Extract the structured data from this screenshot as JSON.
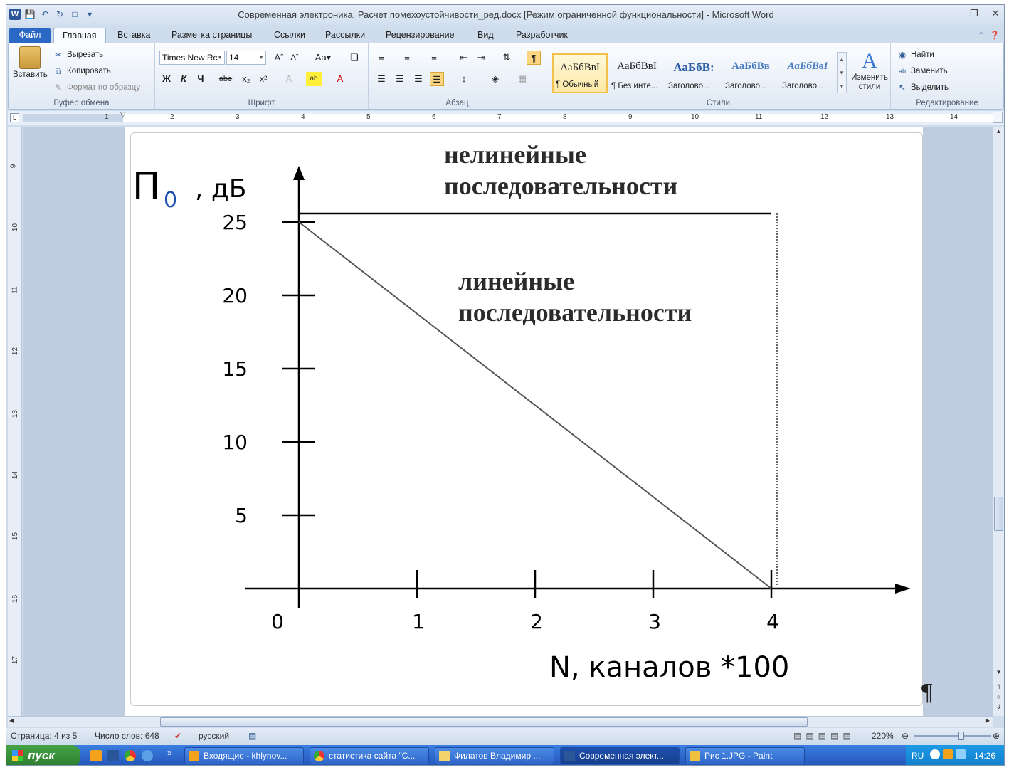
{
  "window": {
    "title": "Современная электроника. Расчет помехоустойчивости_ред.docx [Режим ограниченной функциональности] - Microsoft Word"
  },
  "tabs": [
    {
      "label": "Файл"
    },
    {
      "label": "Главная"
    },
    {
      "label": "Вставка"
    },
    {
      "label": "Разметка страницы"
    },
    {
      "label": "Ссылки"
    },
    {
      "label": "Рассылки"
    },
    {
      "label": "Рецензирование"
    },
    {
      "label": "Вид"
    },
    {
      "label": "Разработчик"
    }
  ],
  "ribbon": {
    "clipboard": {
      "paste": "Вставить",
      "cut": "Вырезать",
      "copy": "Копировать",
      "format_painter": "Формат по образцу",
      "label": "Буфер обмена"
    },
    "font": {
      "name": "Times New Rc",
      "size": "14",
      "bold": "Ж",
      "italic": "К",
      "underline": "Ч",
      "strike": "abe",
      "label": "Шрифт"
    },
    "paragraph": {
      "label": "Абзац"
    },
    "styles": {
      "items": [
        {
          "preview": "АаБбВвI",
          "name": "¶ Обычный"
        },
        {
          "preview": "АаБбВвI",
          "name": "¶ Без инте..."
        },
        {
          "preview": "АаБбВ:",
          "name": "Заголово..."
        },
        {
          "preview": "АаБбВв",
          "name": "Заголово..."
        },
        {
          "preview": "АаБбВвI",
          "name": "Заголово..."
        }
      ],
      "change": "Изменить стили",
      "label": "Стили"
    },
    "editing": {
      "find": "Найти",
      "replace": "Заменить",
      "select": "Выделить",
      "label": "Редактирование"
    }
  },
  "ruler": {
    "h": [
      "1",
      "2",
      "3",
      "4",
      "5",
      "6",
      "7",
      "8",
      "9",
      "10",
      "11",
      "12",
      "13",
      "14"
    ],
    "v": [
      "9",
      "10",
      "11",
      "12",
      "13",
      "14",
      "15",
      "16",
      "17"
    ]
  },
  "chart_data": {
    "type": "line",
    "ylabel_main": "П",
    "ylabel_sub": "0",
    "ylabel_unit": ", дБ",
    "xlabel": "N, каналов *100",
    "yticks": [
      "5",
      "10",
      "15",
      "20",
      "25"
    ],
    "xticks": [
      "0",
      "1",
      "2",
      "3",
      "4"
    ],
    "annotations": [
      "нелинейные",
      "последовательности",
      "линейные",
      "последовательности"
    ],
    "ylim": [
      0,
      26
    ],
    "xlim": [
      0,
      4.5
    ],
    "series": [
      {
        "x": [
          0,
          4
        ],
        "y": [
          25,
          0
        ]
      },
      {
        "x": [
          0,
          4,
          4
        ],
        "y": [
          25,
          25,
          0
        ]
      }
    ]
  },
  "statusbar": {
    "page": "Страница: 4 из 5",
    "words": "Число слов: 648",
    "lang": "русский",
    "zoom": "220%"
  },
  "taskbar": {
    "start": "пуск",
    "items": [
      {
        "label": "Входящие - khlynov..."
      },
      {
        "label": "статистика сайта \"С..."
      },
      {
        "label": "Филатов Владимир ..."
      },
      {
        "label": "Современная элект..."
      },
      {
        "label": "Рис 1.JPG - Paint"
      }
    ],
    "lang": "RU",
    "time": "14:26"
  }
}
